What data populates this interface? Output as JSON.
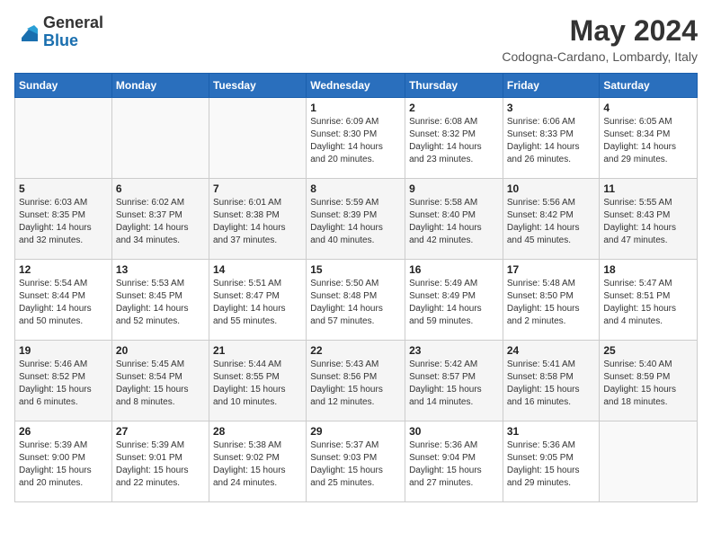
{
  "logo": {
    "general": "General",
    "blue": "Blue"
  },
  "header": {
    "month_year": "May 2024",
    "location": "Codogna-Cardano, Lombardy, Italy"
  },
  "weekdays": [
    "Sunday",
    "Monday",
    "Tuesday",
    "Wednesday",
    "Thursday",
    "Friday",
    "Saturday"
  ],
  "weeks": [
    [
      {
        "day": "",
        "info": ""
      },
      {
        "day": "",
        "info": ""
      },
      {
        "day": "",
        "info": ""
      },
      {
        "day": "1",
        "info": "Sunrise: 6:09 AM\nSunset: 8:30 PM\nDaylight: 14 hours\nand 20 minutes."
      },
      {
        "day": "2",
        "info": "Sunrise: 6:08 AM\nSunset: 8:32 PM\nDaylight: 14 hours\nand 23 minutes."
      },
      {
        "day": "3",
        "info": "Sunrise: 6:06 AM\nSunset: 8:33 PM\nDaylight: 14 hours\nand 26 minutes."
      },
      {
        "day": "4",
        "info": "Sunrise: 6:05 AM\nSunset: 8:34 PM\nDaylight: 14 hours\nand 29 minutes."
      }
    ],
    [
      {
        "day": "5",
        "info": "Sunrise: 6:03 AM\nSunset: 8:35 PM\nDaylight: 14 hours\nand 32 minutes."
      },
      {
        "day": "6",
        "info": "Sunrise: 6:02 AM\nSunset: 8:37 PM\nDaylight: 14 hours\nand 34 minutes."
      },
      {
        "day": "7",
        "info": "Sunrise: 6:01 AM\nSunset: 8:38 PM\nDaylight: 14 hours\nand 37 minutes."
      },
      {
        "day": "8",
        "info": "Sunrise: 5:59 AM\nSunset: 8:39 PM\nDaylight: 14 hours\nand 40 minutes."
      },
      {
        "day": "9",
        "info": "Sunrise: 5:58 AM\nSunset: 8:40 PM\nDaylight: 14 hours\nand 42 minutes."
      },
      {
        "day": "10",
        "info": "Sunrise: 5:56 AM\nSunset: 8:42 PM\nDaylight: 14 hours\nand 45 minutes."
      },
      {
        "day": "11",
        "info": "Sunrise: 5:55 AM\nSunset: 8:43 PM\nDaylight: 14 hours\nand 47 minutes."
      }
    ],
    [
      {
        "day": "12",
        "info": "Sunrise: 5:54 AM\nSunset: 8:44 PM\nDaylight: 14 hours\nand 50 minutes."
      },
      {
        "day": "13",
        "info": "Sunrise: 5:53 AM\nSunset: 8:45 PM\nDaylight: 14 hours\nand 52 minutes."
      },
      {
        "day": "14",
        "info": "Sunrise: 5:51 AM\nSunset: 8:47 PM\nDaylight: 14 hours\nand 55 minutes."
      },
      {
        "day": "15",
        "info": "Sunrise: 5:50 AM\nSunset: 8:48 PM\nDaylight: 14 hours\nand 57 minutes."
      },
      {
        "day": "16",
        "info": "Sunrise: 5:49 AM\nSunset: 8:49 PM\nDaylight: 14 hours\nand 59 minutes."
      },
      {
        "day": "17",
        "info": "Sunrise: 5:48 AM\nSunset: 8:50 PM\nDaylight: 15 hours\nand 2 minutes."
      },
      {
        "day": "18",
        "info": "Sunrise: 5:47 AM\nSunset: 8:51 PM\nDaylight: 15 hours\nand 4 minutes."
      }
    ],
    [
      {
        "day": "19",
        "info": "Sunrise: 5:46 AM\nSunset: 8:52 PM\nDaylight: 15 hours\nand 6 minutes."
      },
      {
        "day": "20",
        "info": "Sunrise: 5:45 AM\nSunset: 8:54 PM\nDaylight: 15 hours\nand 8 minutes."
      },
      {
        "day": "21",
        "info": "Sunrise: 5:44 AM\nSunset: 8:55 PM\nDaylight: 15 hours\nand 10 minutes."
      },
      {
        "day": "22",
        "info": "Sunrise: 5:43 AM\nSunset: 8:56 PM\nDaylight: 15 hours\nand 12 minutes."
      },
      {
        "day": "23",
        "info": "Sunrise: 5:42 AM\nSunset: 8:57 PM\nDaylight: 15 hours\nand 14 minutes."
      },
      {
        "day": "24",
        "info": "Sunrise: 5:41 AM\nSunset: 8:58 PM\nDaylight: 15 hours\nand 16 minutes."
      },
      {
        "day": "25",
        "info": "Sunrise: 5:40 AM\nSunset: 8:59 PM\nDaylight: 15 hours\nand 18 minutes."
      }
    ],
    [
      {
        "day": "26",
        "info": "Sunrise: 5:39 AM\nSunset: 9:00 PM\nDaylight: 15 hours\nand 20 minutes."
      },
      {
        "day": "27",
        "info": "Sunrise: 5:39 AM\nSunset: 9:01 PM\nDaylight: 15 hours\nand 22 minutes."
      },
      {
        "day": "28",
        "info": "Sunrise: 5:38 AM\nSunset: 9:02 PM\nDaylight: 15 hours\nand 24 minutes."
      },
      {
        "day": "29",
        "info": "Sunrise: 5:37 AM\nSunset: 9:03 PM\nDaylight: 15 hours\nand 25 minutes."
      },
      {
        "day": "30",
        "info": "Sunrise: 5:36 AM\nSunset: 9:04 PM\nDaylight: 15 hours\nand 27 minutes."
      },
      {
        "day": "31",
        "info": "Sunrise: 5:36 AM\nSunset: 9:05 PM\nDaylight: 15 hours\nand 29 minutes."
      },
      {
        "day": "",
        "info": ""
      }
    ]
  ]
}
